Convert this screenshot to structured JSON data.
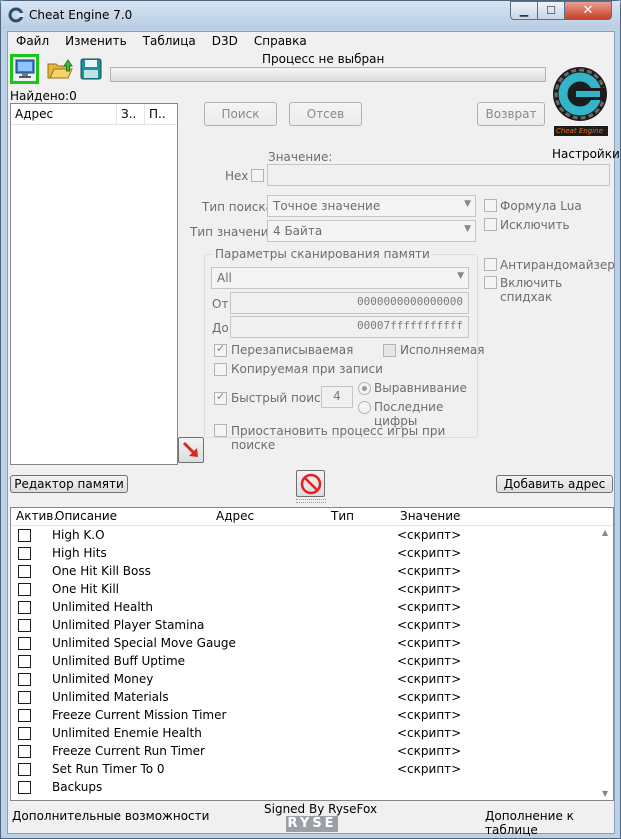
{
  "window": {
    "title": "Cheat Engine 7.0",
    "minimize": "▁",
    "maximize": "☐",
    "close": "✕"
  },
  "menu": [
    "Файл",
    "Изменить",
    "Таблица",
    "D3D",
    "Справка"
  ],
  "process_title": "Процесс не выбран",
  "found_label": "Найдено:0",
  "address_list": {
    "columns": [
      "Адрес",
      "З..",
      "П.."
    ]
  },
  "buttons": {
    "first_scan": "Поиск",
    "next_scan": "Отсев",
    "undo_scan": "Возврат",
    "memory_view": "Редактор памяти",
    "add_address": "Добавить адрес"
  },
  "settings_label": "Настройки",
  "logo_text": "Cheat Engine",
  "scan": {
    "value_label": "Значение:",
    "hex_label": "Hex",
    "scan_type_label": "Тип поиска",
    "scan_type_value": "Точное значение",
    "value_type_label": "Тип значения",
    "value_type_value": "4 Байта",
    "lua_formula": "Формула Lua",
    "not_label": "Исключить",
    "unrandomizer": "Антирандомайзер",
    "speedhack": "Включить спидхак"
  },
  "memory_options": {
    "title": "Параметры сканирования памяти",
    "region": "All",
    "from_label": "От",
    "from_value": "0000000000000000",
    "to_label": "До",
    "to_value": "00007fffffffffff",
    "writable": "Перезаписываемая",
    "executable": "Исполняемая",
    "copy_on_write": "Копируемая при записи",
    "fast_scan": "Быстрый поиск",
    "fast_scan_value": "4",
    "alignment": "Выравнивание",
    "last_digits": "Последние цифры",
    "pause": "Приостановить процесс игры при поиске"
  },
  "cheat_table": {
    "columns": {
      "active": "Актив.",
      "description": "Описание",
      "address": "Адрес",
      "type": "Тип",
      "value": "Значение"
    },
    "rows": [
      {
        "desc": "High K.O",
        "value": "<скрипт>"
      },
      {
        "desc": "High Hits",
        "value": "<скрипт>"
      },
      {
        "desc": "One Hit Kill Boss",
        "value": "<скрипт>"
      },
      {
        "desc": "One Hit Kill",
        "value": "<скрипт>"
      },
      {
        "desc": "Unlimited Health",
        "value": "<скрипт>"
      },
      {
        "desc": "Unlimited Player Stamina",
        "value": "<скрипт>"
      },
      {
        "desc": "Unlimited Special Move Gauge",
        "value": "<скрипт>"
      },
      {
        "desc": "Unlimited Buff Uptime",
        "value": "<скрипт>"
      },
      {
        "desc": "Unlimited Money",
        "value": "<скрипт>"
      },
      {
        "desc": "Unlimited Materials",
        "value": "<скрипт>"
      },
      {
        "desc": "Freeze Current Mission Timer",
        "value": "<скрипт>"
      },
      {
        "desc": "Unlimited Enemie Health",
        "value": "<скрипт>"
      },
      {
        "desc": "Freeze Current Run Timer",
        "value": "<скрипт>"
      },
      {
        "desc": "Set Run Timer To 0",
        "value": "<скрипт>"
      },
      {
        "desc": "Backups",
        "value": ""
      }
    ]
  },
  "footer": {
    "advanced": "Дополнительные возможности",
    "signed": "Signed By RyseFox",
    "brand": "RYSE",
    "table_extras": "Дополнение к таблице"
  }
}
